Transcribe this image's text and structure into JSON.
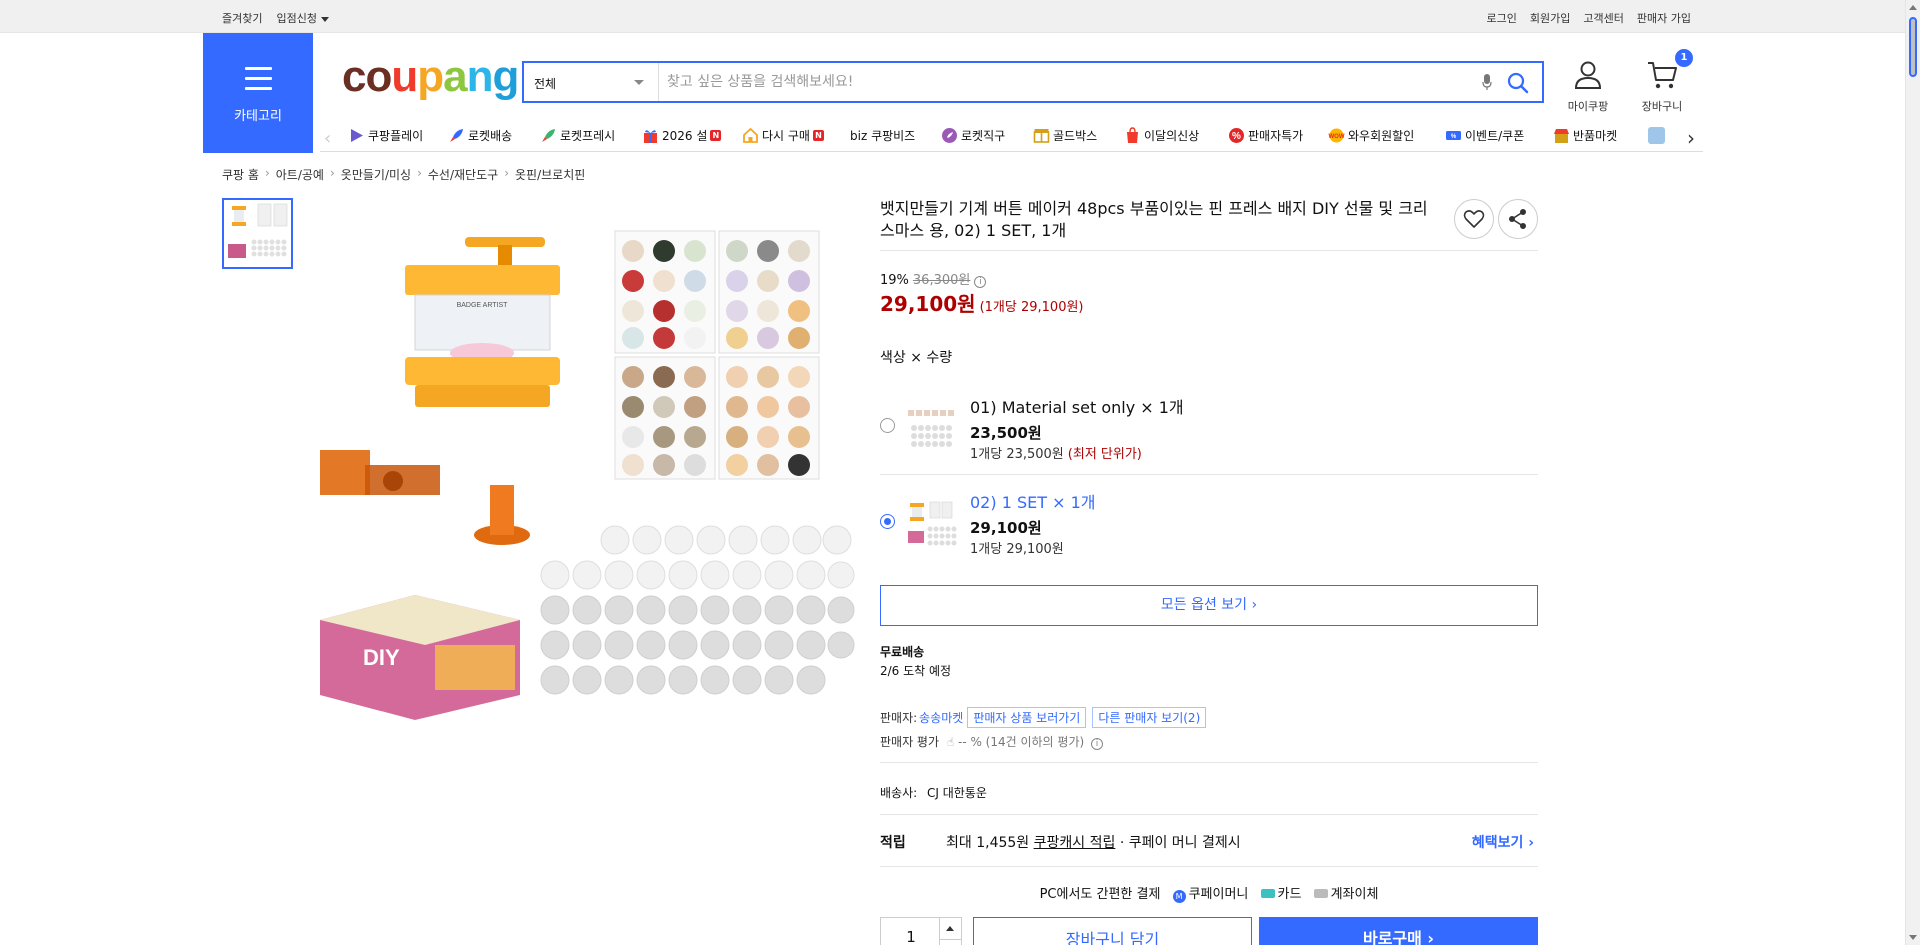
{
  "topbar": {
    "left": [
      "즐겨찾기",
      "입점신청"
    ],
    "right": [
      "로그인",
      "회원가입",
      "고객센터",
      "판매자 가입"
    ]
  },
  "header": {
    "category_label": "카테고리",
    "logo": "coupang",
    "search": {
      "category": "전체",
      "placeholder": "찾고 싶은 상품을 검색해보세요!"
    },
    "mypage_label": "마이쿠팡",
    "cart_label": "장바구니",
    "cart_count": "1"
  },
  "nav": {
    "items": [
      {
        "label": "쿠팡플레이",
        "icon": "play-icon",
        "color": "#6a5acd"
      },
      {
        "label": "로켓배송",
        "icon": "rocket-icon",
        "color": "#346aff"
      },
      {
        "label": "로켓프레시",
        "icon": "rocket-fresh-icon",
        "color": "#3cb371"
      },
      {
        "label": "2026 설",
        "icon": "gift-icon",
        "color": "#ef3a2c",
        "badge": "N"
      },
      {
        "label": "다시 구매",
        "icon": "repurchase-icon",
        "color": "#f5a623",
        "badge": "N"
      },
      {
        "label": "biz 쿠팡비즈",
        "icon": "",
        "color": ""
      },
      {
        "label": "로켓직구",
        "icon": "direct-icon",
        "color": "#9b59b6"
      },
      {
        "label": "골드박스",
        "icon": "goldbox-icon",
        "color": "#d4a017"
      },
      {
        "label": "이달의신상",
        "icon": "new-icon",
        "color": "#ef3a2c"
      },
      {
        "label": "판매자특가",
        "icon": "percent-icon",
        "color": "#e52528"
      },
      {
        "label": "와우회원할인",
        "icon": "wow-icon",
        "color": "#e52528"
      },
      {
        "label": "이벤트/쿠폰",
        "icon": "coupon-icon",
        "color": "#346aff"
      },
      {
        "label": "반품마켓",
        "icon": "market-icon",
        "color": "#d4a017"
      }
    ]
  },
  "breadcrumb": [
    "쿠팡 홈",
    "아트/공예",
    "옷만들기/미싱",
    "수선/재단도구",
    "옷핀/브로치핀"
  ],
  "product": {
    "title": "뱃지만들기 기계 버튼 메이커 48pcs 부품이있는 핀 프레스 배지 DIY 선물 및 크리스마스 용, 02) 1 SET, 1개",
    "discount_rate": "19%",
    "original_price": "36,300원",
    "price": "29,100원",
    "unit_price": "(1개당 29,100원)",
    "option_header": "색상 × 수량",
    "image_badge_text": "BADGE ARTIST",
    "image_box_text": "DIY"
  },
  "options": [
    {
      "name": "01) Material set only × 1개",
      "price": "23,500원",
      "unit": "1개당 23,500원",
      "note": "(최저 단위가)",
      "selected": false
    },
    {
      "name": "02) 1 SET × 1개",
      "price": "29,100원",
      "unit": "1개당 29,100원",
      "note": "",
      "selected": true
    }
  ],
  "all_options_label": "모든 옵션 보기",
  "shipping": {
    "type": "무료배송",
    "eta": "2/6 도착 예정"
  },
  "seller": {
    "label": "판매자:",
    "name": "송송마켓",
    "view_products": "판매자 상품 보러가기",
    "other_sellers": "다른 판매자 보기(2)",
    "rating_label": "판매자 평가",
    "rating_value": "-- % (14건 이하의 평가)"
  },
  "carrier": {
    "label": "배송사:",
    "name": "CJ 대한통운"
  },
  "reward": {
    "label": "적립",
    "max": "최대 1,455원",
    "cash": "쿠팡캐시 적립",
    "tail": "· 쿠페이 머니 결제시",
    "more": "혜택보기"
  },
  "pc_pay": {
    "title": "PC에서도 간편한 결제",
    "methods": [
      "쿠페이머니",
      "카드",
      "계좌이체"
    ]
  },
  "purchase": {
    "quantity": "1",
    "add_cart": "장바구니 담기",
    "buy_now": "바로구매"
  }
}
